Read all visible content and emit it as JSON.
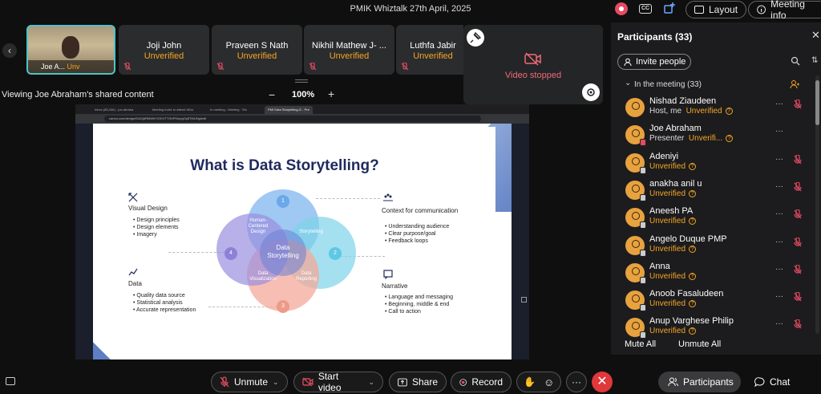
{
  "meeting": {
    "title": "PMIK Whiztalk 27th April, 2025"
  },
  "topbar": {
    "cc_label": "CC",
    "layout_label": "Layout",
    "meeting_info_label": "Meeting info"
  },
  "filmstrip": {
    "self": {
      "name": "Joe A...",
      "status": "Unv"
    },
    "tiles": [
      {
        "name": "Joji John",
        "status": "Unverified"
      },
      {
        "name": "Praveen S Nath",
        "status": "Unverified"
      },
      {
        "name": "Nikhil Mathew J- ...",
        "status": "Unverified"
      },
      {
        "name": "Luthfa Jabir",
        "status": "Unverified"
      }
    ],
    "video_stopped": "Video stopped"
  },
  "viewer": {
    "label": "Viewing Joe Abraham's shared content",
    "zoom_minus": "−",
    "zoom": "100%",
    "zoom_plus": "+"
  },
  "browser": {
    "tabs": [
      "Inbox (85,436) - joe.abraha",
      "Meeting invite to attend Whiz",
      "In meeting - Meeting · Sin",
      "PMI Data Storytelling-G - Pre"
    ],
    "url": "canva.com/design/DAGjdRMWbY/OKVT7GhPSmpgOy8TMUNg/edit"
  },
  "slide": {
    "title": "What is Data Storytelling?",
    "visual_design": {
      "title": "Visual Design",
      "items": [
        "Design principles",
        "Design elements",
        "Imagery"
      ]
    },
    "data": {
      "title": "Data",
      "items": [
        "Quality data source",
        "Statistical analysis",
        "Accurate representation"
      ]
    },
    "context": {
      "title": "Context for communication",
      "items": [
        "Understanding audience",
        "Clear purpose/goal",
        "Feedback loops"
      ]
    },
    "narrative": {
      "title": "Narrative",
      "items": [
        "Language and messaging",
        "Beginning, middle & end",
        "Call to action"
      ]
    },
    "venn": {
      "human": "Human-\nCentered\nDesign",
      "storytelling": "Storytelling",
      "center": "Data\nStorytelling",
      "visualization": "Data\nVisualization",
      "reporting": "Data\nReporting",
      "n1": "1",
      "n2": "2",
      "n3": "3",
      "n4": "4"
    },
    "colors": {
      "c1": "#7fb6ee",
      "c2": "#7dd3ea",
      "c3": "#f4a99a",
      "c4": "#9a8fe0",
      "title": "#1f2a5c"
    }
  },
  "participants": {
    "title": "Participants (33)",
    "invite_label": "Invite people",
    "section_label": "In the meeting (33)",
    "people": [
      {
        "name": "Nishad Ziaudeen",
        "role": "Host, me",
        "status": "Unverified",
        "mic": true,
        "device": ""
      },
      {
        "name": "Joe Abraham",
        "role": "Presenter",
        "status": "Unverifi...",
        "mic": false,
        "device": "red"
      },
      {
        "name": "Adeniyi",
        "role": "",
        "status": "Unverified",
        "mic": true,
        "device": "grey"
      },
      {
        "name": "anakha anil u",
        "role": "",
        "status": "Unverified",
        "mic": true,
        "device": "grey"
      },
      {
        "name": "Aneesh PA",
        "role": "",
        "status": "Unverified",
        "mic": true,
        "device": "grey"
      },
      {
        "name": "Angelo Duque PMP",
        "role": "",
        "status": "Unverified",
        "mic": true,
        "device": "grey"
      },
      {
        "name": "Anna",
        "role": "",
        "status": "Unverified",
        "mic": true,
        "device": "grey"
      },
      {
        "name": "Anoob Fasaludeen",
        "role": "",
        "status": "Unverified",
        "mic": true,
        "device": "grey"
      },
      {
        "name": "Anup Varghese Philip",
        "role": "",
        "status": "Unverified",
        "mic": true,
        "device": "grey"
      }
    ],
    "mute_all": "Mute All",
    "unmute_all": "Unmute All"
  },
  "controls": {
    "unmute": "Unmute",
    "start_video": "Start video",
    "share": "Share",
    "record": "Record",
    "more": "···",
    "participants": "Participants",
    "chat": "Chat"
  }
}
